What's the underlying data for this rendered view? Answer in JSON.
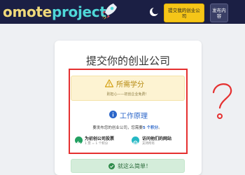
{
  "header": {
    "logo_part1": "omote",
    "logo_part2": "project",
    "submit_button": "提交我的创业公司",
    "post_button": "发布内容"
  },
  "card": {
    "title": "提交你的创业公司",
    "points": {
      "heading": "所需学分",
      "desc": "别担心——初创企业免费！"
    },
    "how": {
      "heading": "工作原理",
      "desc_prefix": "要发布您的创业公司，您需要",
      "desc_highlight": "5 个积分",
      "desc_suffix": "。"
    },
    "options": [
      {
        "title": "为初创公司投票",
        "sub": "1 票 = 1 个积分"
      },
      {
        "title": "访问他们的网站",
        "sub": "支持所有"
      }
    ],
    "simple_text": "就这么简单！"
  },
  "annotation": {
    "mark": "?"
  },
  "colors": {
    "topbar": "#1b1f44",
    "accent_yellow": "#f5c518",
    "annotation_red": "#e53030",
    "info_blue": "#2b66c9"
  }
}
